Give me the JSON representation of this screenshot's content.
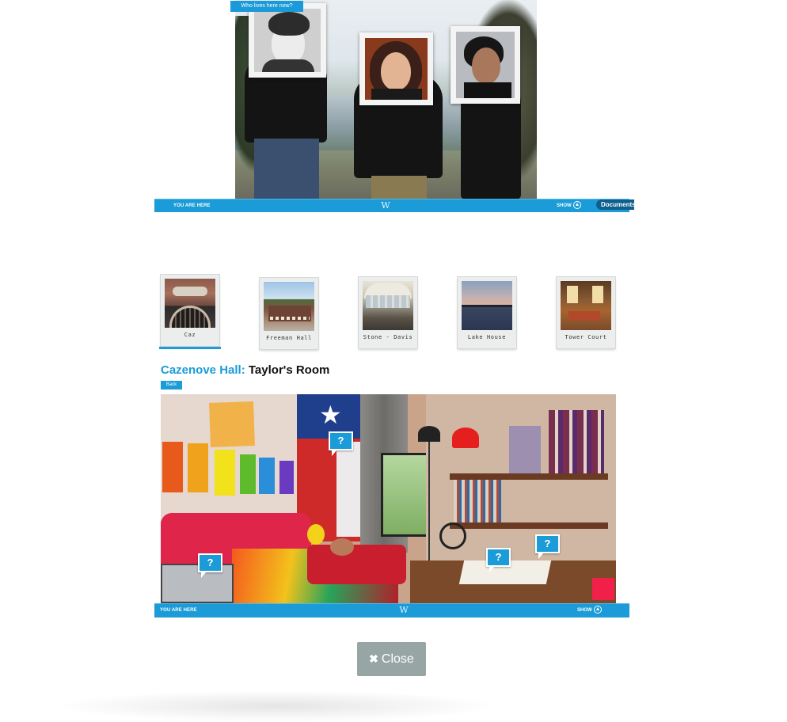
{
  "hero": {
    "tag": "Who lives here now?",
    "bar": {
      "you_are_here": "YOU ARE HERE",
      "logo": "W",
      "show": "SHOW",
      "document_btn": "Documents"
    }
  },
  "dorms": [
    {
      "label": "Caz",
      "selected": true
    },
    {
      "label": "Freeman Hall",
      "selected": false
    },
    {
      "label": "Stone - Davis",
      "selected": false
    },
    {
      "label": "Lake House",
      "selected": false
    },
    {
      "label": "Tower Court",
      "selected": false
    }
  ],
  "room": {
    "hall": "Cazenove Hall:",
    "name": "Taylor's Room",
    "back": "Back",
    "hotspot_label": "?",
    "bar": {
      "you_are_here": "YOU ARE HERE",
      "logo": "W",
      "show": "SHOW"
    }
  },
  "close": {
    "label": "Close",
    "icon": "close-icon"
  },
  "colors": {
    "accent": "#1b9bd7",
    "close_bg": "#98a5a5"
  }
}
